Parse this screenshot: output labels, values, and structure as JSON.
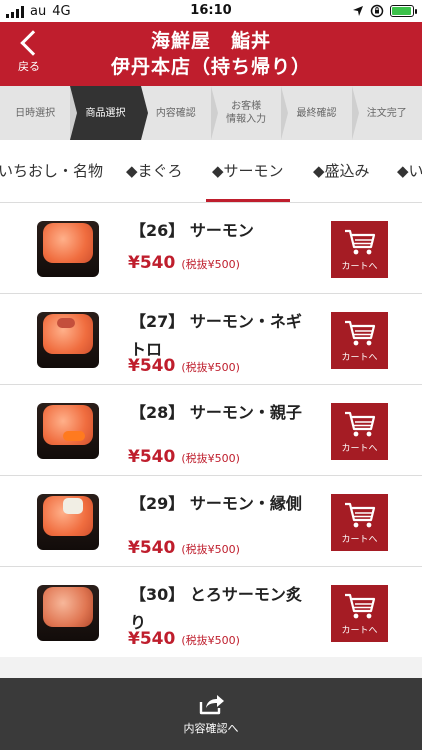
{
  "status": {
    "carrier": "au",
    "network": "4G",
    "time": "16:10"
  },
  "header": {
    "back_label": "戻る",
    "title_line1": "海鮮屋　鮨丼",
    "title_line2": "伊丹本店（持ち帰り）"
  },
  "steps": [
    {
      "label": "日時選択"
    },
    {
      "label": "商品選択"
    },
    {
      "label": "内容確認"
    },
    {
      "label": "お客様\n情報入力"
    },
    {
      "label": "最終確認"
    },
    {
      "label": "注文完了"
    }
  ],
  "tabs": [
    {
      "label": "いちおし・名物"
    },
    {
      "label": "◆まぐろ"
    },
    {
      "label": "◆サーモン"
    },
    {
      "label": "◆盛込み"
    },
    {
      "label": "◆い"
    }
  ],
  "items": [
    {
      "name": "【26】 サーモン",
      "price": "¥540",
      "tax": "(税抜¥500)",
      "cart_label": "カートへ"
    },
    {
      "name": "【27】 サーモン・ネギトロ",
      "price": "¥540",
      "tax": "(税抜¥500)",
      "cart_label": "カートへ"
    },
    {
      "name": "【28】 サーモン・親子",
      "price": "¥540",
      "tax": "(税抜¥500)",
      "cart_label": "カートへ"
    },
    {
      "name": "【29】 サーモン・縁側",
      "price": "¥540",
      "tax": "(税抜¥500)",
      "cart_label": "カートへ"
    },
    {
      "name": "【30】 とろサーモン炙り",
      "price": "¥540",
      "tax": "(税抜¥500)",
      "cart_label": "カートへ"
    }
  ],
  "bottom": {
    "label": "内容確認へ"
  },
  "colors": {
    "brand_red": "#bf1e2d",
    "cart_red": "#a51c24",
    "step_active": "#333333",
    "bottom_bar": "#3a3a3a"
  },
  "icons": {
    "back": "chevron-left-icon",
    "cart": "shopping-cart-icon",
    "next": "share-arrow-icon"
  }
}
